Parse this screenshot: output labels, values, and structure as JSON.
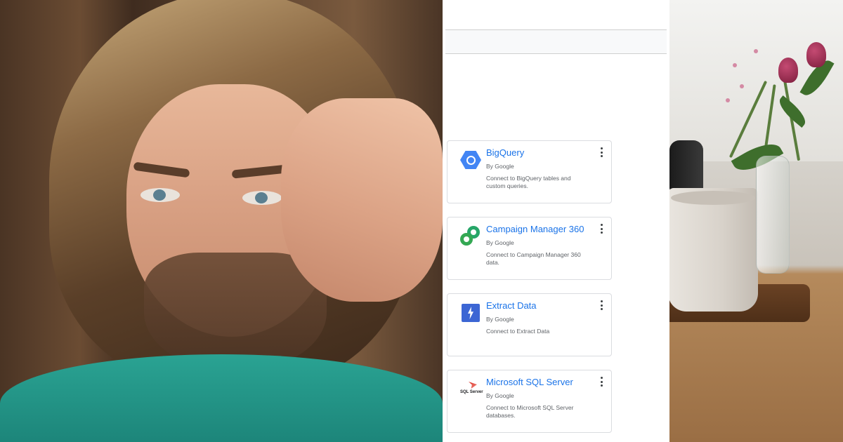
{
  "connectors": [
    {
      "title": "BigQuery",
      "by": "By Google",
      "description": "Connect to BigQuery tables and custom queries.",
      "icon": "bigquery-icon"
    },
    {
      "title": "Campaign Manager 360",
      "by": "By Google",
      "description": "Connect to Campaign Manager 360 data.",
      "icon": "campaign-manager-icon"
    },
    {
      "title": "Extract Data",
      "by": "By Google",
      "description": "Connect to Extract Data",
      "icon": "extract-data-icon"
    },
    {
      "title": "Microsoft SQL Server",
      "by": "By Google",
      "description": "Connect to Microsoft SQL Server databases.",
      "icon": "sql-server-icon",
      "logo_text": "SQL Server"
    }
  ],
  "colors": {
    "link_blue": "#1a73e8",
    "bigquery_blue": "#4285f4",
    "campaign_green": "#34a853",
    "extract_blue": "#3c66d4",
    "sql_red": "#d93025",
    "shirt_teal": "#2aa393"
  }
}
